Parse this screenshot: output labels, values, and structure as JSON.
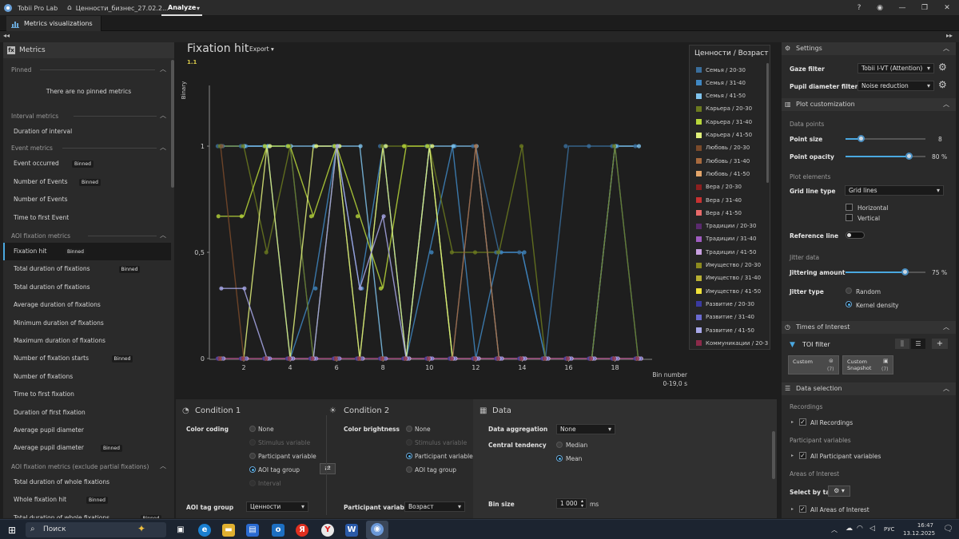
{
  "titlebar": {
    "app_name": "Tobii Pro Lab",
    "project_tab": "Ценности_бизнес_27.02.2...",
    "analyze_tab": "Analyze"
  },
  "viewbar": {
    "tab_label": "Metrics visualizations"
  },
  "left": {
    "title": "Metrics",
    "pinned_label": "Pinned",
    "pinned_empty": "There are no pinned metrics",
    "sections": [
      {
        "label": "Interval metrics",
        "items": [
          {
            "label": "Duration of interval",
            "badge": ""
          }
        ]
      },
      {
        "label": "Event metrics",
        "items": [
          {
            "label": "Event occurred",
            "badge": "Binned"
          },
          {
            "label": "Number of Events",
            "badge": "Binned"
          },
          {
            "label": "Number of Events",
            "badge": ""
          },
          {
            "label": "Time to first Event",
            "badge": ""
          }
        ]
      },
      {
        "label": "AOI fixation metrics",
        "items": [
          {
            "label": "Fixation hit",
            "badge": "Binned"
          },
          {
            "label": "Total duration of fixations",
            "badge": "Binned"
          },
          {
            "label": "Total duration of fixations",
            "badge": ""
          },
          {
            "label": "Average duration of fixations",
            "badge": ""
          },
          {
            "label": "Minimum duration of fixations",
            "badge": ""
          },
          {
            "label": "Maximum duration of fixations",
            "badge": ""
          },
          {
            "label": "Number of fixation starts",
            "badge": "Binned"
          },
          {
            "label": "Number of fixations",
            "badge": ""
          },
          {
            "label": "Time to first fixation",
            "badge": ""
          },
          {
            "label": "Duration of first fixation",
            "badge": ""
          },
          {
            "label": "Average pupil diameter",
            "badge": ""
          },
          {
            "label": "Average pupil diameter",
            "badge": "Binned"
          }
        ]
      },
      {
        "label": "AOI fixation metrics (exclude partial fixations)",
        "items": [
          {
            "label": "Total duration of whole fixations",
            "badge": ""
          },
          {
            "label": "Whole fixation hit",
            "badge": "Binned"
          },
          {
            "label": "Total duration of whole fixations",
            "badge": "Binned"
          }
        ]
      }
    ]
  },
  "plot": {
    "title": "Fixation hit",
    "export_label": "Export",
    "y_max_label": "1.1",
    "ylabel": "Binary",
    "xlabel": "Bin number",
    "x_range_label": "0-19,0 s",
    "legend_title": "Ценности / Возраст"
  },
  "chart_data": {
    "type": "line",
    "ylabel": "Binary",
    "xlabel": "Bin number",
    "ylim": [
      0,
      1.1
    ],
    "xlim": [
      0,
      19
    ],
    "y_ticks": [
      "0",
      "0,5",
      "1"
    ],
    "x_ticks": [
      2,
      4,
      6,
      8,
      10,
      12,
      14,
      16,
      18
    ],
    "legend_placement": "right",
    "series": [
      {
        "name": "Семья / 20-30",
        "color": "#3a6e9c",
        "values": [
          1,
          1,
          1,
          1,
          0,
          1,
          0,
          1,
          0,
          1,
          0,
          1,
          0.5,
          0.5,
          0,
          1,
          1,
          1,
          1
        ]
      },
      {
        "name": "Семья / 31-40",
        "color": "#3f87c2",
        "values": [
          1,
          1,
          1,
          0,
          0.33,
          1,
          0.33,
          1,
          0,
          0.5,
          1,
          0,
          0.5,
          0.5,
          0,
          0,
          0,
          1,
          0
        ]
      },
      {
        "name": "Семья / 41-50",
        "color": "#7fc3ec",
        "values": [
          1,
          1,
          1,
          1,
          1,
          1,
          1,
          0,
          0,
          1,
          1,
          1,
          0,
          0,
          0,
          0,
          0,
          1,
          1
        ]
      },
      {
        "name": "Карьера / 20-30",
        "color": "#6b7a1e",
        "values": [
          1,
          1,
          0.5,
          1,
          0,
          1,
          0,
          1,
          1,
          1,
          0.5,
          0.5,
          0.5,
          1,
          0,
          0,
          0,
          1,
          0
        ]
      },
      {
        "name": "Карьера / 31-40",
        "color": "#b7d63a",
        "values": [
          0.67,
          0.67,
          1,
          1,
          0.67,
          1,
          0.67,
          0.33,
          1,
          1,
          0,
          0,
          0,
          0,
          0,
          0,
          0,
          0,
          0
        ]
      },
      {
        "name": "Карьера / 41-50",
        "color": "#e0f07a",
        "values": [
          0,
          0,
          1,
          0,
          1,
          1,
          0,
          1,
          0,
          1,
          0,
          0,
          0,
          0,
          0,
          0,
          0,
          0,
          0
        ]
      },
      {
        "name": "Любовь / 20-30",
        "color": "#7a4a2a",
        "values": [
          1,
          0,
          0,
          0,
          0,
          0,
          0,
          0,
          0,
          0,
          0,
          0,
          0,
          0,
          0,
          0,
          0,
          0,
          0
        ]
      },
      {
        "name": "Любовь / 31-40",
        "color": "#a86a3e",
        "values": [
          0,
          0,
          0,
          0,
          0,
          0,
          0,
          0,
          0,
          0,
          0,
          1,
          0,
          0,
          0,
          0,
          0,
          0,
          0
        ]
      },
      {
        "name": "Любовь / 41-50",
        "color": "#e3a56a",
        "values": [
          0,
          0,
          0,
          0,
          0,
          0,
          0,
          0,
          0,
          0,
          0,
          0,
          0,
          0,
          0,
          0,
          0,
          0,
          0
        ]
      },
      {
        "name": "Вера / 20-30",
        "color": "#8c1f1f",
        "values": [
          0,
          0,
          0,
          0,
          0,
          0,
          0,
          0,
          0,
          0,
          0,
          0,
          0,
          0,
          0,
          0,
          0,
          0,
          0
        ]
      },
      {
        "name": "Вера / 31-40",
        "color": "#c83232",
        "values": [
          0,
          0,
          0,
          0,
          0,
          0,
          0,
          0,
          0,
          0,
          0,
          0,
          0,
          0,
          0,
          0,
          0,
          0,
          0
        ]
      },
      {
        "name": "Вера / 41-50",
        "color": "#e86a6a",
        "values": [
          0,
          0,
          0,
          0,
          0,
          0,
          0,
          0,
          0,
          0,
          0,
          0,
          0,
          0,
          0,
          0,
          0,
          0,
          0
        ]
      },
      {
        "name": "Традиции / 20-30",
        "color": "#5a2a6e",
        "values": [
          0,
          0,
          0,
          0,
          0,
          0,
          0,
          0,
          0,
          0,
          0,
          0,
          0,
          0,
          0,
          0,
          0,
          0,
          0
        ]
      },
      {
        "name": "Традиции / 31-40",
        "color": "#a05cc0",
        "values": [
          0,
          0,
          0,
          0,
          0,
          0,
          0,
          0,
          0,
          0,
          0,
          0,
          0,
          0,
          0,
          0,
          0,
          0,
          0
        ]
      },
      {
        "name": "Традиции / 41-50",
        "color": "#c8a0e0",
        "values": [
          0,
          0,
          0,
          0,
          0,
          0,
          0,
          0,
          0,
          0,
          0,
          0,
          0,
          0,
          0,
          0,
          0,
          0,
          0
        ]
      },
      {
        "name": "Имущество / 20-30",
        "color": "#8c8a1e",
        "values": [
          0,
          0,
          0,
          0,
          0,
          0,
          0,
          0,
          0,
          0,
          0,
          0,
          0,
          0,
          0,
          0,
          0,
          0,
          0
        ]
      },
      {
        "name": "Имущество / 31-40",
        "color": "#b8b032",
        "values": [
          0,
          0,
          0,
          0,
          0,
          0,
          0,
          0,
          0,
          0,
          0,
          0,
          0,
          0,
          0,
          0,
          0,
          0,
          0
        ]
      },
      {
        "name": "Имущество / 41-50",
        "color": "#f0e23a",
        "values": [
          0,
          0,
          0,
          0,
          0,
          0,
          0,
          0,
          0,
          0,
          0,
          0,
          0,
          0,
          0,
          0,
          0,
          0,
          0
        ]
      },
      {
        "name": "Развитие / 20-30",
        "color": "#3a3aa0",
        "values": [
          0,
          0,
          0,
          0,
          0,
          0,
          0,
          0,
          0,
          0,
          0,
          0,
          0,
          0,
          0,
          0,
          0,
          0,
          0
        ]
      },
      {
        "name": "Развитие / 31-40",
        "color": "#6a6ad0",
        "values": [
          0,
          0,
          0,
          0,
          0,
          0,
          0,
          0,
          0,
          0,
          0,
          0,
          0,
          0,
          0,
          0,
          0,
          0,
          0
        ]
      },
      {
        "name": "Развитие / 41-50",
        "color": "#a8a8e8",
        "values": [
          0.33,
          0.33,
          0,
          0,
          0,
          1,
          0.33,
          0.67,
          0,
          0,
          0,
          0,
          0,
          0,
          0,
          0,
          0,
          0,
          0
        ]
      },
      {
        "name": "Коммуникации / 20-3",
        "color": "#8c2a4a",
        "values": [
          0,
          0,
          0,
          0,
          0,
          0,
          0,
          0,
          0,
          0,
          0,
          0,
          0,
          0,
          0,
          0,
          0,
          0,
          0
        ]
      }
    ]
  },
  "condition1": {
    "title": "Condition 1",
    "color_coding_label": "Color coding",
    "options": [
      "None",
      "Stimulus variable",
      "Participant variable",
      "AOI tag group",
      "Interval"
    ],
    "aoi_tag_group_label": "AOI tag group",
    "aoi_tag_group_value": "Ценности"
  },
  "condition2": {
    "title": "Condition 2",
    "color_brightness_label": "Color brightness",
    "options": [
      "None",
      "Stimulus variable",
      "Participant variable",
      "AOI tag group"
    ],
    "participant_variable_label": "Participant variable",
    "participant_variable_value": "Возраст"
  },
  "data_panel": {
    "title": "Data",
    "aggregation_label": "Data aggregation",
    "aggregation_value": "None",
    "central_tendency_label": "Central tendency",
    "median_label": "Median",
    "mean_label": "Mean",
    "bin_size_label": "Bin size",
    "bin_size_value": "1 000",
    "bin_size_unit": "ms"
  },
  "settings": {
    "title": "Settings",
    "gaze_filter_label": "Gaze filter",
    "gaze_filter_value": "Tobii I-VT (Attention)",
    "pupil_filter_label": "Pupil diameter filter",
    "pupil_filter_value": "Noise reduction"
  },
  "plot_custom": {
    "title": "Plot customization",
    "data_points_label": "Data points",
    "point_size_label": "Point size",
    "point_size_value": "8",
    "point_size_fraction": 0.2,
    "point_opacity_label": "Point opacity",
    "point_opacity_value": "80",
    "point_opacity_fraction": 0.8,
    "percent_unit": "%",
    "plot_elements_label": "Plot elements",
    "grid_line_type_label": "Grid line type",
    "grid_line_type_value": "Grid lines",
    "horizontal_label": "Horizontal",
    "vertical_label": "Vertical",
    "reference_line_label": "Reference line",
    "jitter_data_label": "Jitter data",
    "jitter_amount_label": "Jittering amount",
    "jitter_amount_value": "75",
    "jitter_amount_fraction": 0.75,
    "jitter_type_label": "Jitter type",
    "random_label": "Random",
    "kernel_label": "Kernel density"
  },
  "toi": {
    "title": "Times of Interest",
    "filter_label": "TOI filter",
    "chips": [
      {
        "label": "Custom",
        "count": "(7)"
      },
      {
        "label": "Custom Snapshot",
        "count": "(7)"
      }
    ]
  },
  "data_selection": {
    "title": "Data selection",
    "recordings_label": "Recordings",
    "all_recordings": "All Recordings",
    "participant_vars_label": "Participant variables",
    "all_participant_vars": "All Participant variables",
    "aoi_label": "Areas of Interest",
    "select_by_tag": "Select by tag",
    "all_aoi": "All Areas of Interest"
  },
  "taskbar": {
    "search_label": "Поиск",
    "lang": "РУС",
    "time": "16:47",
    "date": "13.12.2025"
  },
  "colors": {
    "accent": "#4aa8e0",
    "bg": "#1e1e1e",
    "panel": "#2a2a2a"
  }
}
